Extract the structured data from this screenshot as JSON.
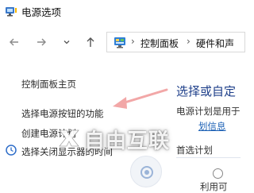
{
  "window": {
    "title": "电源选项",
    "icon": "power-options-icon"
  },
  "nav": {
    "back_icon": "arrow-left-icon",
    "forward_icon": "arrow-right-icon",
    "dropdown_icon": "chevron-down-icon",
    "up_icon": "arrow-up-icon",
    "address": {
      "icon": "control-panel-icon",
      "crumbs": [
        "控制面板",
        "硬件和声"
      ]
    }
  },
  "left_pane": {
    "home_link": "控制面板主页",
    "links": [
      "选择电源按钮的功能",
      "创建电源计划",
      "选择关闭显示器的时间"
    ]
  },
  "right_pane": {
    "heading": "选择或自定",
    "desc": "电源计划是用于",
    "link_partial": "划信息",
    "preferred_label": "首选计划",
    "bottom_label": "利用可"
  },
  "overlay": {
    "watermark_text": "自由互联",
    "arrow_color": "#f2a7a7"
  }
}
